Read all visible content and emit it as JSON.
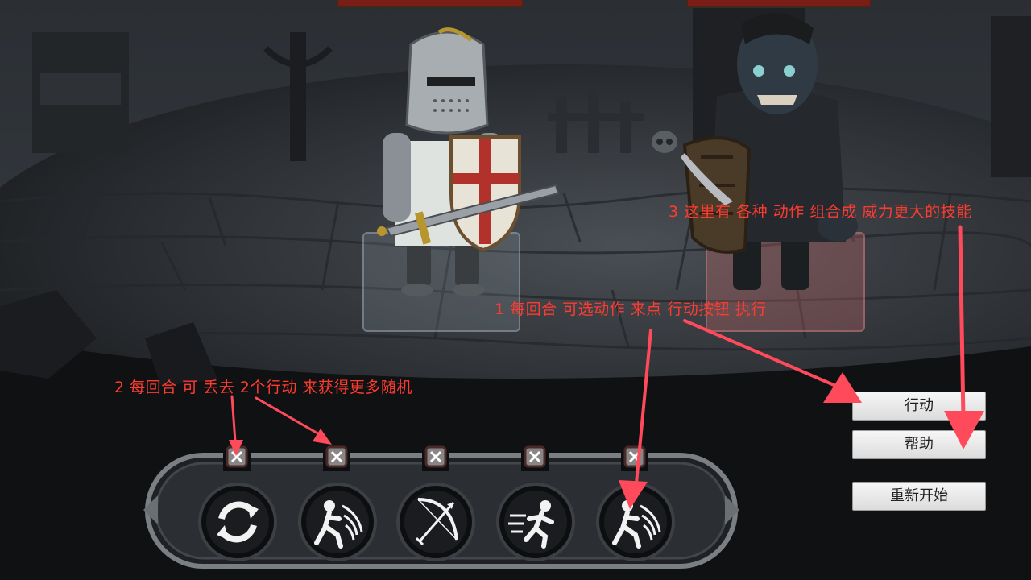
{
  "annotations": {
    "note1": "1 每回合 可选动作 来点 行动按钮 执行",
    "note2": "2 每回合 可 丢去 2个行动 来获得更多随机",
    "note3": "3 这里有 各种 动作 组合成 威力更大的技能"
  },
  "buttons": {
    "act": "行动",
    "help": "帮助",
    "restart": "重新开始"
  },
  "action_slots": [
    {
      "icon": "refresh-icon"
    },
    {
      "icon": "dash-strike-icon"
    },
    {
      "icon": "bow-icon"
    },
    {
      "icon": "run-icon"
    },
    {
      "icon": "dash-strike-icon"
    }
  ],
  "colors": {
    "annotation_red": "#ff3b30",
    "arrow_red": "#ff4a5c",
    "hp_red": "#7a1d16"
  }
}
